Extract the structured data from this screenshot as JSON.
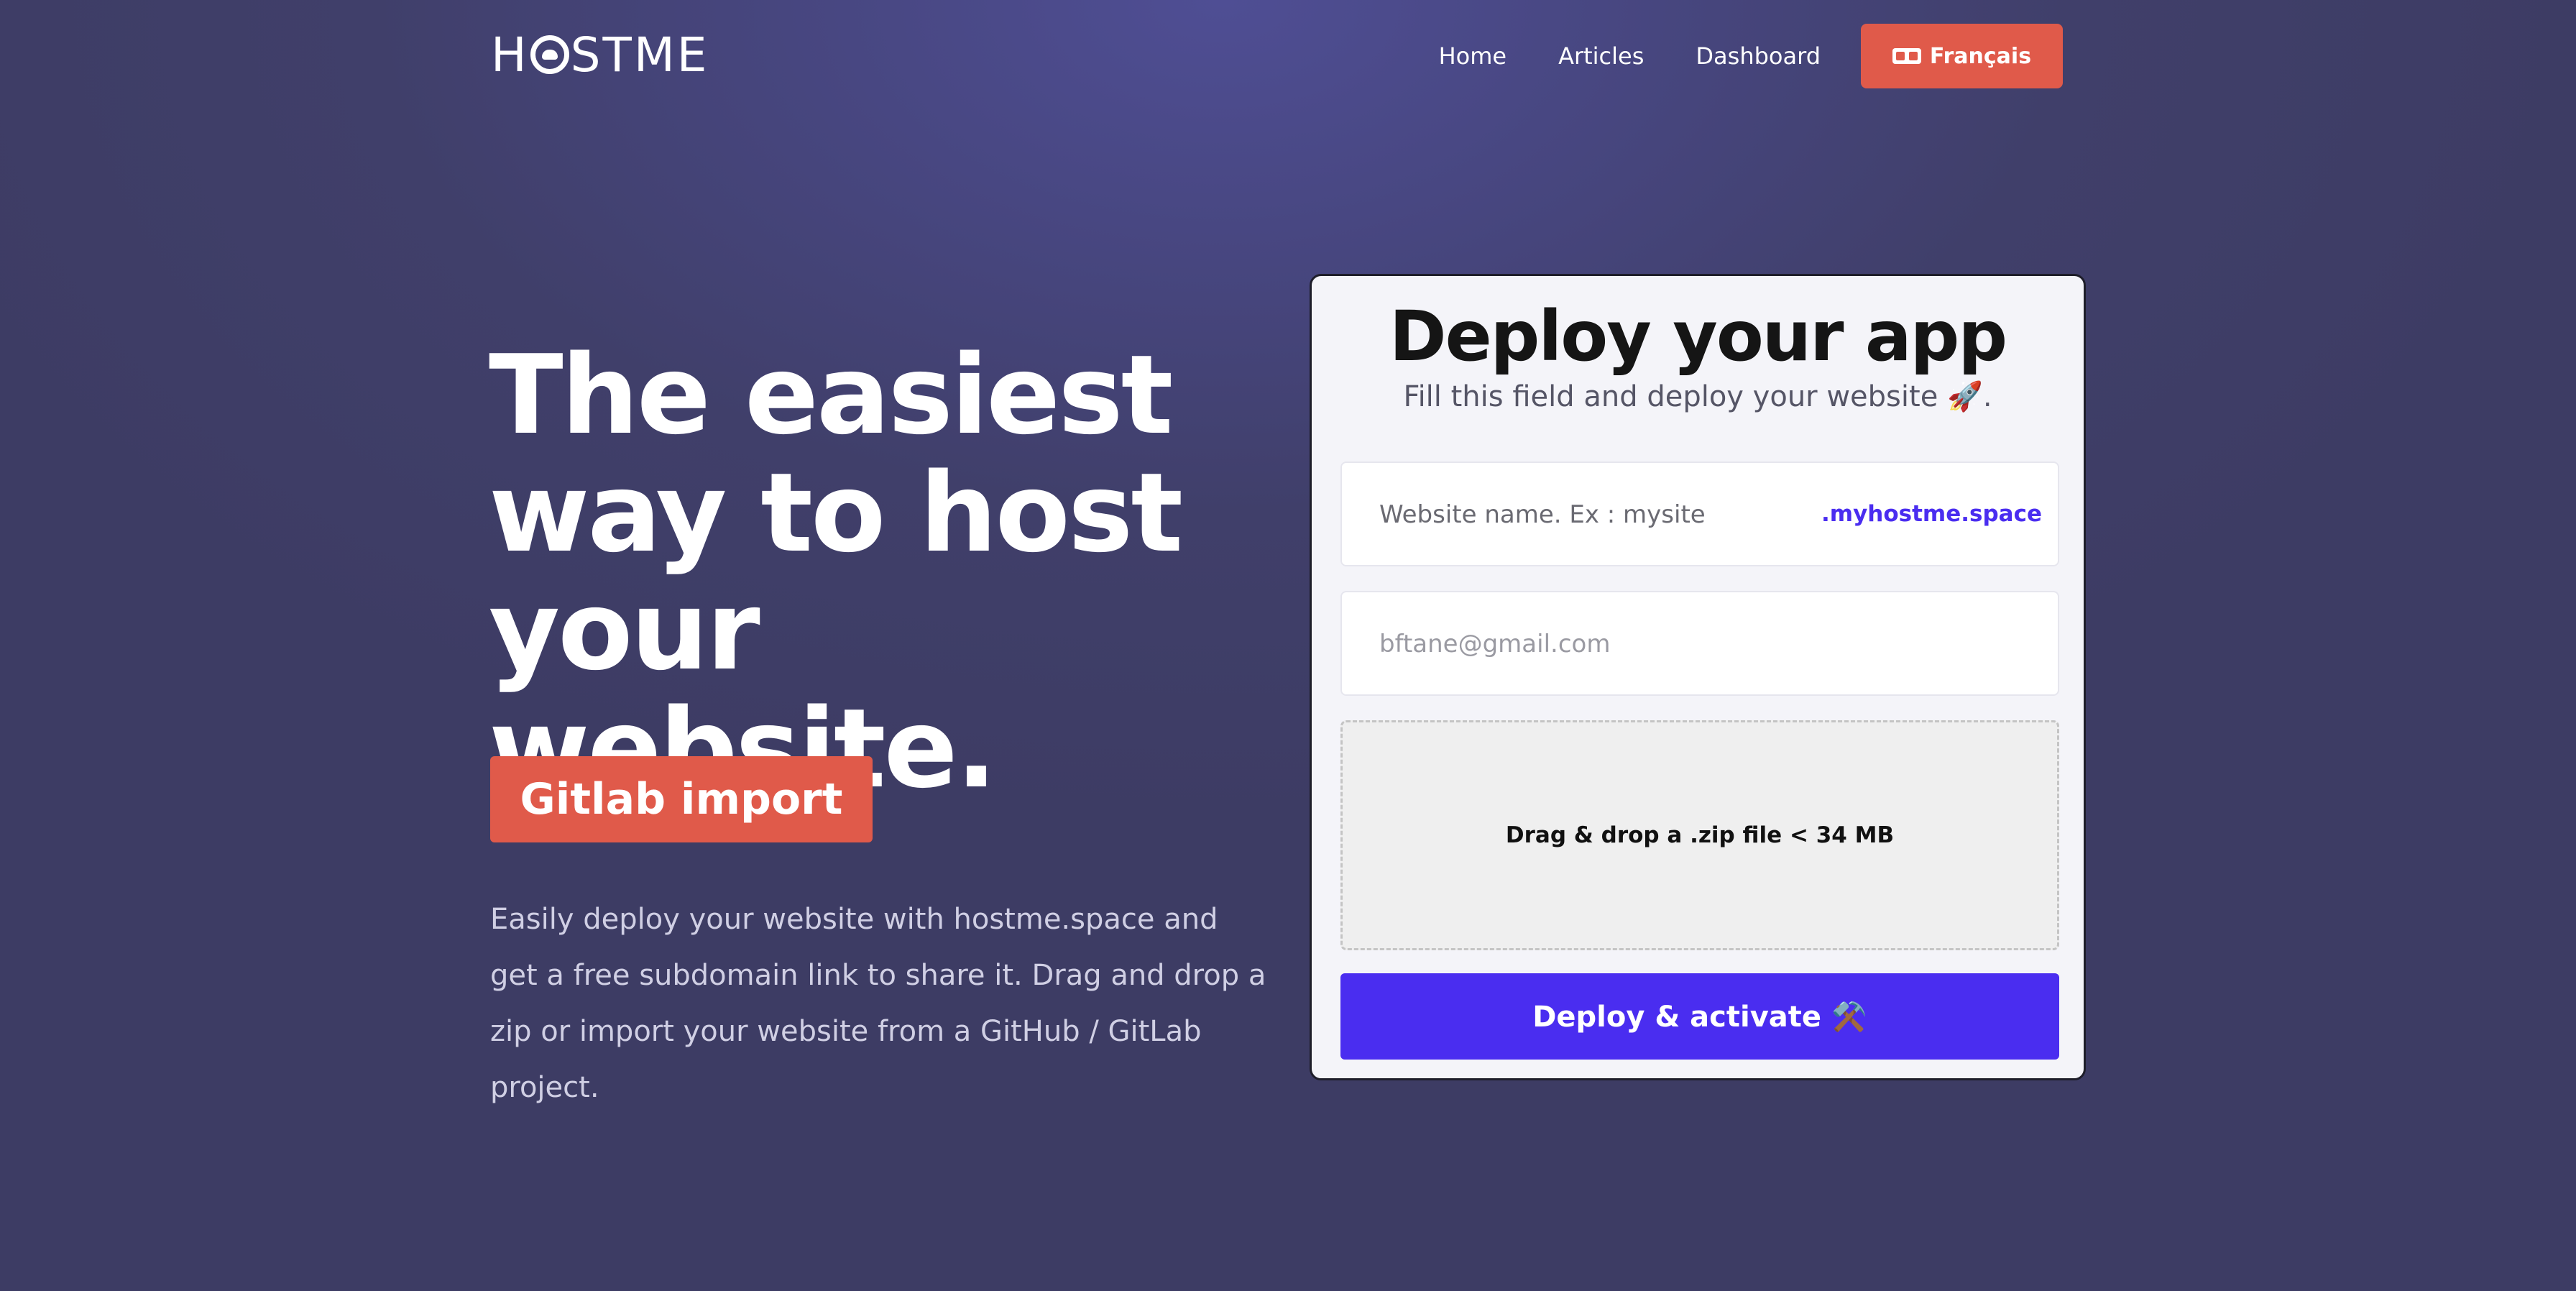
{
  "header": {
    "logo_left": "H",
    "logo_right": "STME",
    "nav": {
      "home": "Home",
      "articles": "Articles",
      "dashboard": "Dashboard"
    },
    "language_button": "Français"
  },
  "hero": {
    "title_line1": "The easiest",
    "title_line2": "way to host",
    "title_line3": "your website.",
    "gitlab_button": "Gitlab import",
    "description": "Easily deploy your website with hostme.space and get a free subdomain link to share it. Drag and drop a zip or import your website from a GitHub / GitLab project."
  },
  "deploy_card": {
    "title": "Deploy your app",
    "subtitle": "Fill this field and deploy your website 🚀.",
    "website_name_placeholder": "Website name. Ex : mysite",
    "domain_suffix": ".myhostme.space",
    "email_placeholder": "bftane@gmail.com",
    "dropzone_text": "Drag & drop a .zip file < 34 MB",
    "deploy_button": "Deploy & activate ⚒️"
  }
}
